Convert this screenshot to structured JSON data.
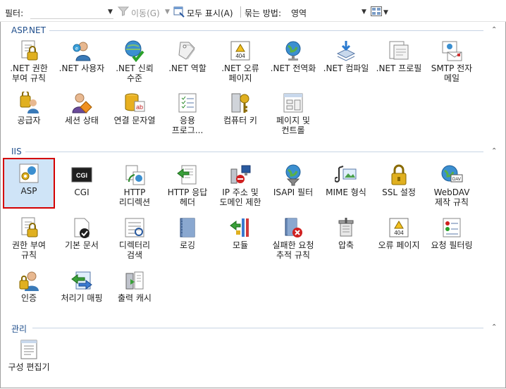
{
  "toolbar": {
    "filter_label": "필터:",
    "filter_value": "",
    "go_label": "이동(G)",
    "show_all_label": "모두 표시(A)",
    "group_label": "묶는 방법:",
    "group_value": "영역"
  },
  "groups": {
    "aspnet": {
      "title": "ASP.NET",
      "items": [
        {
          "label": ".NET 권한\n부여 규칙",
          "icon": "lock-document-icon"
        },
        {
          "label": ".NET 사용자",
          "icon": "user-icon"
        },
        {
          "label": ".NET 신뢰\n수준",
          "icon": "globe-check-icon"
        },
        {
          "label": ".NET 역할",
          "icon": "tags-icon"
        },
        {
          "label": ".NET 오류\n페이지",
          "icon": "error-page-icon"
        },
        {
          "label": ".NET 전역화",
          "icon": "globe-icon"
        },
        {
          "label": ".NET 컴파일",
          "icon": "download-stack-icon"
        },
        {
          "label": ".NET 프로필",
          "icon": "profile-icon"
        },
        {
          "label": "SMTP 전자\n메일",
          "icon": "email-icon"
        },
        {
          "label": "공급자",
          "icon": "provider-icon"
        },
        {
          "label": "세션 상태",
          "icon": "session-icon"
        },
        {
          "label": "연결 문자열",
          "icon": "database-icon"
        },
        {
          "label": "응용\n프로그...",
          "icon": "list-icon"
        },
        {
          "label": "컴퓨터 키",
          "icon": "key-icon"
        },
        {
          "label": "페이지 및\n컨트롤",
          "icon": "page-controls-icon"
        }
      ]
    },
    "iis": {
      "title": "IIS",
      "items": [
        {
          "label": "ASP",
          "icon": "asp-icon"
        },
        {
          "label": "CGI",
          "icon": "cgi-icon"
        },
        {
          "label": "HTTP\n리디렉션",
          "icon": "redirect-icon"
        },
        {
          "label": "HTTP 응답\n헤더",
          "icon": "response-header-icon"
        },
        {
          "label": "IP 주소 및\n도메인 제한",
          "icon": "ip-restrict-icon"
        },
        {
          "label": "ISAPI 필터",
          "icon": "isapi-filter-icon"
        },
        {
          "label": "MIME 형식",
          "icon": "mime-icon"
        },
        {
          "label": "SSL 설정",
          "icon": "padlock-icon"
        },
        {
          "label": "WebDAV\n제작 규칙",
          "icon": "webdav-icon"
        },
        {
          "label": "권한 부여\n규칙",
          "icon": "auth-rules-icon"
        },
        {
          "label": "기본 문서",
          "icon": "default-doc-icon"
        },
        {
          "label": "디렉터리\n검색",
          "icon": "directory-browse-icon"
        },
        {
          "label": "로깅",
          "icon": "logging-icon"
        },
        {
          "label": "모듈",
          "icon": "modules-icon"
        },
        {
          "label": "실패한 요청\n추적 규칙",
          "icon": "failed-request-icon"
        },
        {
          "label": "압축",
          "icon": "compression-icon"
        },
        {
          "label": "오류 페이지",
          "icon": "error-pages-icon"
        },
        {
          "label": "요청 필터링",
          "icon": "request-filter-icon"
        },
        {
          "label": "인증",
          "icon": "authentication-icon"
        },
        {
          "label": "처리기 매핑",
          "icon": "handler-mapping-icon"
        },
        {
          "label": "출력 캐시",
          "icon": "output-cache-icon"
        }
      ]
    },
    "management": {
      "title": "관리",
      "items": [
        {
          "label": "구성 편집기",
          "icon": "config-editor-icon"
        }
      ]
    }
  },
  "colors": {
    "selection_border": "#d40000",
    "selection_fill": "#cfe4f7",
    "group_header": "#1f4e8c"
  }
}
